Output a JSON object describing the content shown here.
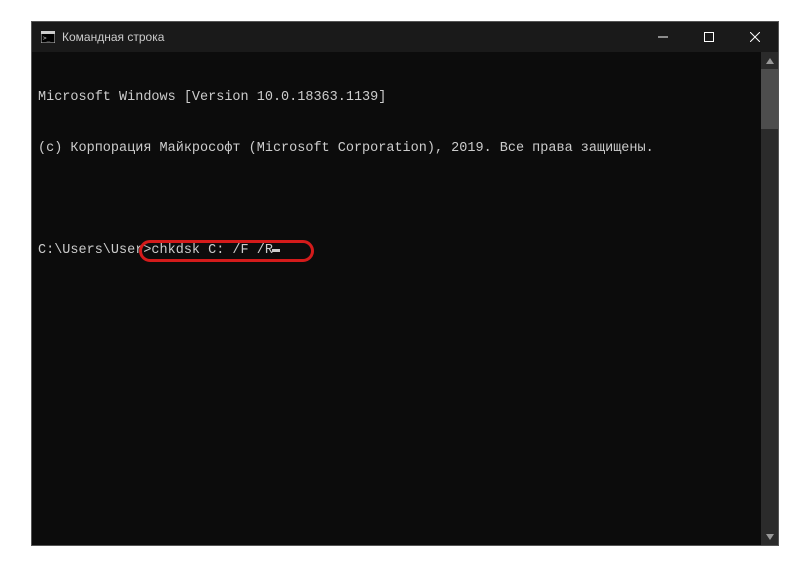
{
  "window": {
    "title": "Командная строка"
  },
  "terminal": {
    "line1": "Microsoft Windows [Version 10.0.18363.1139]",
    "line2": "(c) Корпорация Майкрософт (Microsoft Corporation), 2019. Все права защищены.",
    "prompt": "C:\\Users\\User>",
    "command": "chkdsk C: /F /R"
  }
}
